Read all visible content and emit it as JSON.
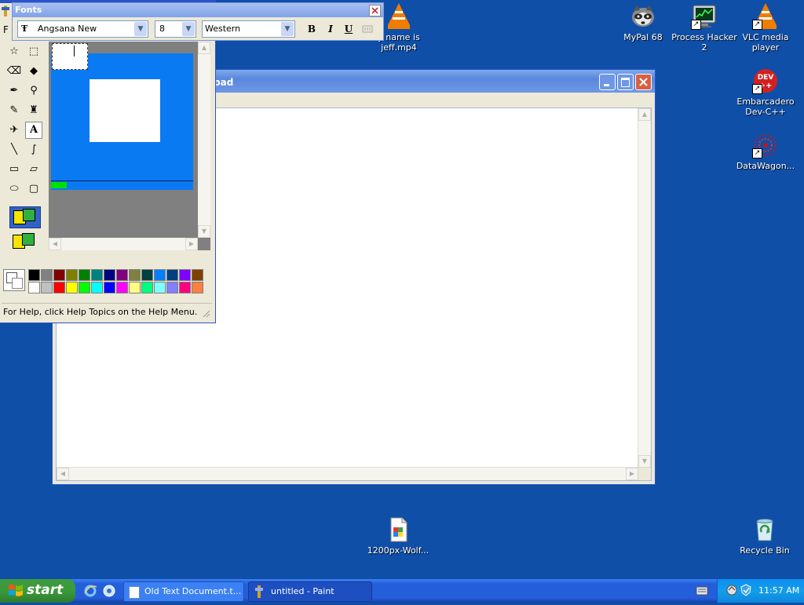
{
  "desktop": {
    "icons": [
      {
        "label": "y name is jeff.mp4",
        "icon": "vlc-cone-icon"
      },
      {
        "label": "MyPal 68",
        "icon": "raccoon-icon"
      },
      {
        "label": "Process Hacker 2",
        "icon": "monitor-icon"
      },
      {
        "label": "VLC media player",
        "icon": "vlc-cone-icon"
      },
      {
        "label": "Embarcadero Dev-C++",
        "icon": "dev-cpp-icon"
      },
      {
        "label": "DataWagon...",
        "icon": "red-ball-icon"
      },
      {
        "label": "1200px-Wolf...",
        "icon": "image-file-icon"
      },
      {
        "label": "Recycle Bin",
        "icon": "recycle-bin-icon"
      }
    ],
    "shortcut_arrow": "↗"
  },
  "notepad": {
    "title_suffix": "pad"
  },
  "paint": {
    "menu_first_letter": "F",
    "status": "For Help, click Help Topics on the Help Menu.",
    "palette_top": [
      "#000000",
      "#808080",
      "#800000",
      "#808000",
      "#008000",
      "#008080",
      "#000080",
      "#800080",
      "#808040",
      "#004040",
      "#0080ff",
      "#004080",
      "#8000ff",
      "#804000"
    ],
    "palette_bottom": [
      "#ffffff",
      "#c0c0c0",
      "#ff0000",
      "#ffff00",
      "#00ff00",
      "#00ffff",
      "#0000ff",
      "#ff00ff",
      "#ffff80",
      "#00ff80",
      "#80ffff",
      "#8080ff",
      "#ff0080",
      "#ff8040"
    ],
    "canvas_color": "#0a7af2"
  },
  "fonts_toolbar": {
    "title": "Fonts",
    "font_name": "Angsana New",
    "font_size": "8",
    "script": "Western",
    "bold": "B",
    "italic": "I",
    "underline": "U"
  },
  "taskbar": {
    "start_label": "start",
    "tasks": [
      {
        "label": "Old Text Document.t..."
      },
      {
        "label": "untitled - Paint"
      }
    ],
    "clock": "11:57 AM"
  }
}
